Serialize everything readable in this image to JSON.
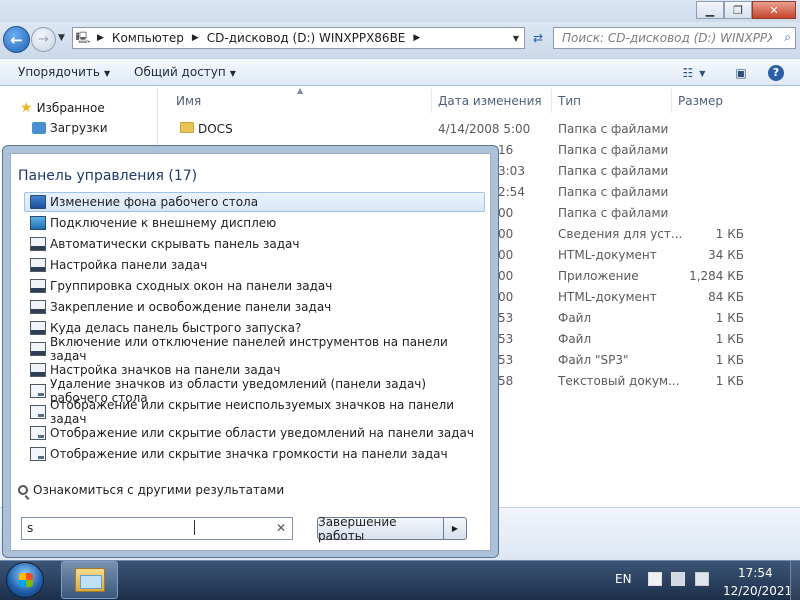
{
  "explorer": {
    "address": {
      "crumbs": [
        "Компьютер",
        "CD-дисковод (D:) WINXPPX86BE"
      ]
    },
    "search_placeholder": "Поиск: CD-дисковод (D:) WINXPPX86...",
    "toolbar": {
      "organize": "Упорядочить",
      "share": "Общий доступ"
    },
    "nav": {
      "favorites": "Избранное",
      "downloads": "Загрузки"
    },
    "columns": {
      "name": "Имя",
      "date": "Дата изменения",
      "type": "Тип",
      "size": "Размер"
    },
    "files": [
      {
        "name": "DOCS",
        "date": "4/14/2008 5:00",
        "type": "Папка с файлами",
        "size": ""
      },
      {
        "name": "",
        "date": "16",
        "type": "Папка с файлами",
        "size": ""
      },
      {
        "name": "",
        "date": "3:03",
        "type": "Папка с файлами",
        "size": ""
      },
      {
        "name": "",
        "date": "2:54",
        "type": "Папка с файлами",
        "size": ""
      },
      {
        "name": "",
        "date": "00",
        "type": "Папка с файлами",
        "size": ""
      },
      {
        "name": "",
        "date": "00",
        "type": "Сведения для уст...",
        "size": "1 КБ"
      },
      {
        "name": "",
        "date": "00",
        "type": "HTML-документ",
        "size": "34 КБ"
      },
      {
        "name": "",
        "date": "00",
        "type": "Приложение",
        "size": "1,284 КБ"
      },
      {
        "name": "",
        "date": "00",
        "type": "HTML-документ",
        "size": "84 КБ"
      },
      {
        "name": "",
        "date": "53",
        "type": "Файл",
        "size": "1 КБ"
      },
      {
        "name": "",
        "date": "53",
        "type": "Файл",
        "size": "1 КБ"
      },
      {
        "name": "",
        "date": "53",
        "type": "Файл \"SP3\"",
        "size": "1 КБ"
      },
      {
        "name": "",
        "date": "58",
        "type": "Текстовый докум...",
        "size": "1 КБ"
      }
    ]
  },
  "start_menu": {
    "header": "Панель управления (17)",
    "items": [
      {
        "label": "Изменение фона рабочего стола",
        "icon": "desktop-background-icon"
      },
      {
        "label": "Подключение к внешнему дисплею",
        "icon": "display-icon"
      },
      {
        "label": "Автоматически скрывать панель задач",
        "icon": "taskbar-icon"
      },
      {
        "label": "Настройка панели задач",
        "icon": "taskbar-icon"
      },
      {
        "label": "Группировка сходных окон на панели задач",
        "icon": "taskbar-icon"
      },
      {
        "label": "Закрепление и освобождение панели задач",
        "icon": "taskbar-icon"
      },
      {
        "label": "Куда делась панель быстрого запуска?",
        "icon": "taskbar-icon"
      },
      {
        "label": "Включение или отключение панелей инструментов на панели задач",
        "icon": "taskbar-icon"
      },
      {
        "label": "Настройка значков на панели задач",
        "icon": "taskbar-icon"
      },
      {
        "label": "Удаление значков из области уведомлений (панели задач) рабочего стола",
        "icon": "notification-area-icon"
      },
      {
        "label": "Отображение или скрытие неиспользуемых значков на панели задач",
        "icon": "notification-area-icon"
      },
      {
        "label": "Отображение или скрытие области уведомлений на панели задач",
        "icon": "notification-area-icon"
      },
      {
        "label": "Отображение или скрытие значка громкости на панели задач",
        "icon": "notification-area-icon"
      }
    ],
    "more_results": "Ознакомиться с другими результатами",
    "search_value": "s",
    "shutdown": "Завершение работы"
  },
  "taskbar": {
    "language": "EN",
    "time": "17:54",
    "date": "12/20/2021"
  }
}
